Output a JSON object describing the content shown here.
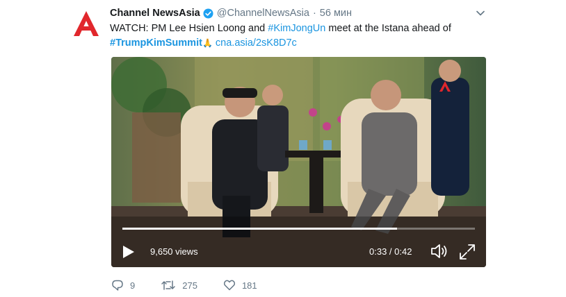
{
  "tweet": {
    "author_name": "Channel NewsAsia",
    "handle": "@ChannelNewsAsia",
    "separator": "·",
    "time": "56 мин",
    "text_prefix": "WATCH: PM Lee Hsien Loong and ",
    "hashtag1": "#KimJongUn",
    "text_middle": " meet at the Istana ahead of",
    "hashtag2": "#TrumpKimSummit",
    "emoji": "🙏",
    "link": "cna.asia/2sK8D7c"
  },
  "video": {
    "views": "9,650 views",
    "time": "0:33 / 0:42",
    "progress": 0.78
  },
  "actions": {
    "replies": "9",
    "retweets": "275",
    "likes": "181"
  },
  "colors": {
    "brand_red": "#e1272c",
    "link_blue": "#1b95e0",
    "verified_blue": "#1da1f2",
    "muted": "#657786"
  },
  "icons": {
    "avatar": "channel-newsasia-logo",
    "verified": "verified-badge-icon",
    "menu": "chevron-down-icon",
    "play": "play-icon",
    "volume": "volume-icon",
    "fullscreen": "fullscreen-icon",
    "reply": "reply-icon",
    "retweet": "retweet-icon",
    "like": "heart-icon"
  }
}
